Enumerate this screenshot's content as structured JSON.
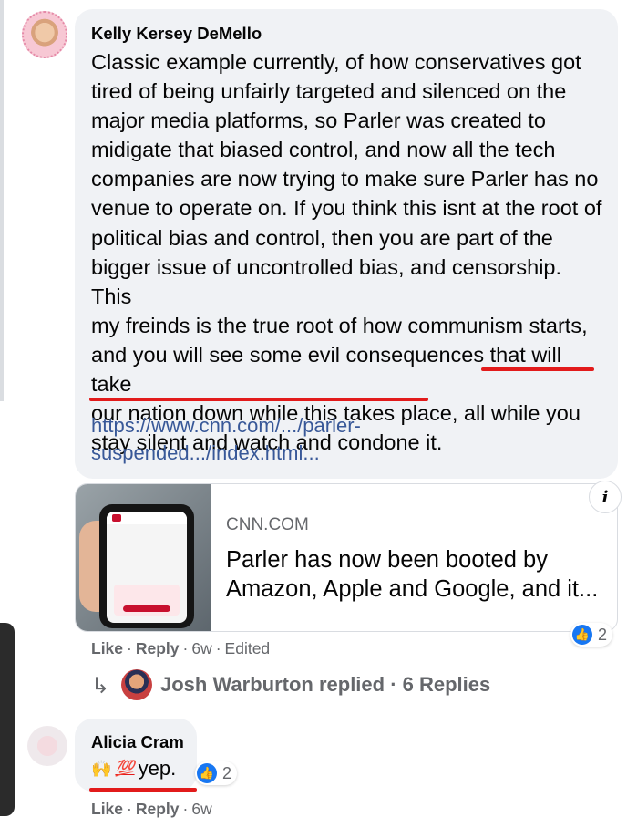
{
  "comment": {
    "author": "Kelly Kersey DeMello",
    "lines": [
      "Classic example currently, of how conservatives got",
      "tired of being unfairly targeted and silenced on the",
      "major media platforms, so Parler was created to",
      "midigate that biased control, and now all the tech",
      "companies are now trying to make sure Parler has no",
      "venue to operate on. If you think this isnt at the root of",
      "political bias and control, then you are part of the",
      "bigger issue of uncontrolled bias, and censorship. This",
      "my freinds is the true root of how communism starts,",
      "and you will see some evil consequences that will take",
      "our nation down while this takes place, all while you",
      "stay silent and watch and condone it."
    ],
    "link_lines": [
      "https://www.cnn.com/.../parler-",
      "suspended.../index.html..."
    ],
    "reactions_count": "2",
    "actions": {
      "like": "Like",
      "reply": "Reply",
      "time": "6w",
      "edited": "Edited"
    }
  },
  "link_preview": {
    "domain": "CNN.COM",
    "headline_lines": [
      "Parler has now been booted by",
      "Amazon, Apple and Google, and it..."
    ],
    "info_icon": "i"
  },
  "replies_summary": {
    "arrow_icon": "↳",
    "text": "Josh Warburton replied · 6 Replies"
  },
  "reply_comment": {
    "author": "Alicia Cram",
    "emoji_hands": "🙌",
    "emoji_100": "💯",
    "text": "yep.",
    "reactions_count": "2",
    "actions": {
      "like": "Like",
      "reply": "Reply",
      "time": "6w"
    }
  },
  "colors": {
    "underline": "#e21b1b",
    "link": "#385898",
    "like_blue": "#1877f2"
  }
}
